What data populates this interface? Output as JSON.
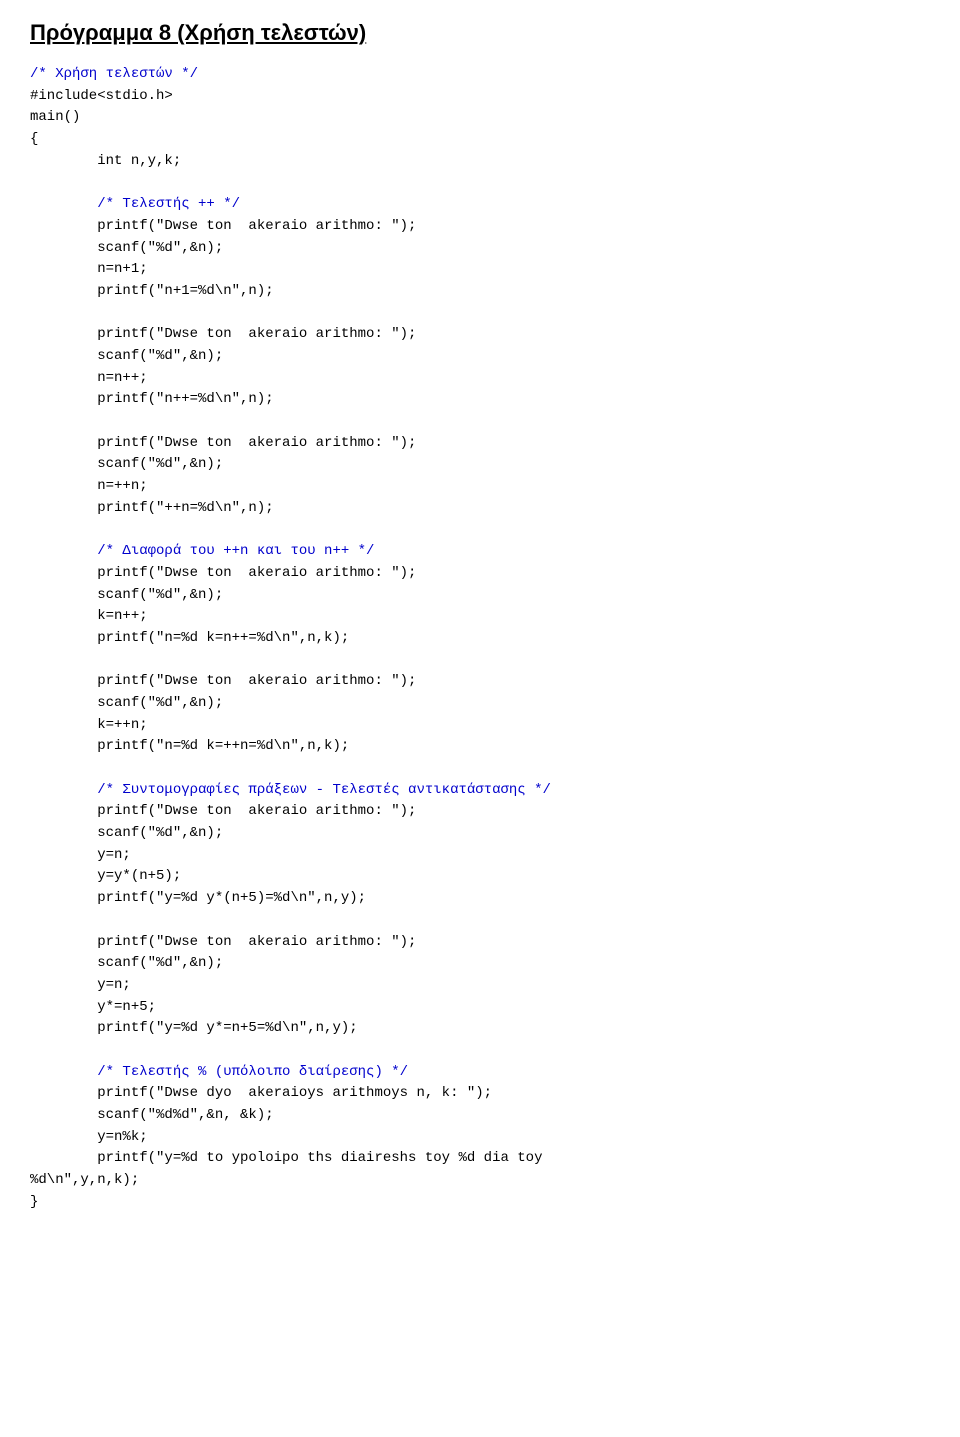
{
  "page": {
    "title": "Πρόγραμμα 8 (Χρήση τελεστών)",
    "code": {
      "comment1": "/* Χρήση τελεστών */",
      "include": "#include<stdio.h>",
      "main_open": "main()\n{",
      "vars": "        int n,y,k;",
      "comment2": "        /* Τελεστής ++ */",
      "block1": "        printf(\"Dwse ton  akeraio arithmo: \");\n        scanf(\"%d\",&n);\n        n=n+1;\n        printf(\"n+1=%d\\n\",n);",
      "block2": "        printf(\"Dwse ton  akeraio arithmo: \");\n        scanf(\"%d\",&n);\n        n=n++;\n        printf(\"n++=%d\\n\",n);",
      "block3": "        printf(\"Dwse ton  akeraio arithmo: \");\n        scanf(\"%d\",&n);\n        n=++n;\n        printf(\"++n=%d\\n\",n);",
      "comment3": "        /* Διαφορά του ++n και του n++ */",
      "block4": "        printf(\"Dwse ton  akeraio arithmo: \");\n        scanf(\"%d\",&n);\n        k=n++;\n        printf(\"n=%d k=n++=%d\\n\",n,k);",
      "block5": "        printf(\"Dwse ton  akeraio arithmo: \");\n        scanf(\"%d\",&n);\n        k=++n;\n        printf(\"n=%d k=++n=%d\\n\",n,k);",
      "comment4": "        /* Συντομογραφίες πράξεων - Τελεστές αντικατάστασης */",
      "block6": "        printf(\"Dwse ton  akeraio arithmo: \");\n        scanf(\"%d\",&n);\n        y=n;\n        y=y*(n+5);\n        printf(\"y=%d y*(n+5)=%d\\n\",n,y);",
      "block7": "        printf(\"Dwse ton  akeraio arithmo: \");\n        scanf(\"%d\",&n);\n        y=n;\n        y*=n+5;\n        printf(\"y=%d y*=n+5=%d\\n\",n,y);",
      "comment5": "        /* Τελεστής % (υπόλοιπο διαίρεσης) */",
      "block8": "        printf(\"Dwse dyo  akeraioys arithmoys n, k: \");\n        scanf(\"%d%d\",&n, &k);\n        y=n%k;\n        printf(\"y=%d to ypoloipo ths diaireshs toy %d dia toy\n%d\\n\",y,n,k);",
      "main_close": "}"
    }
  }
}
